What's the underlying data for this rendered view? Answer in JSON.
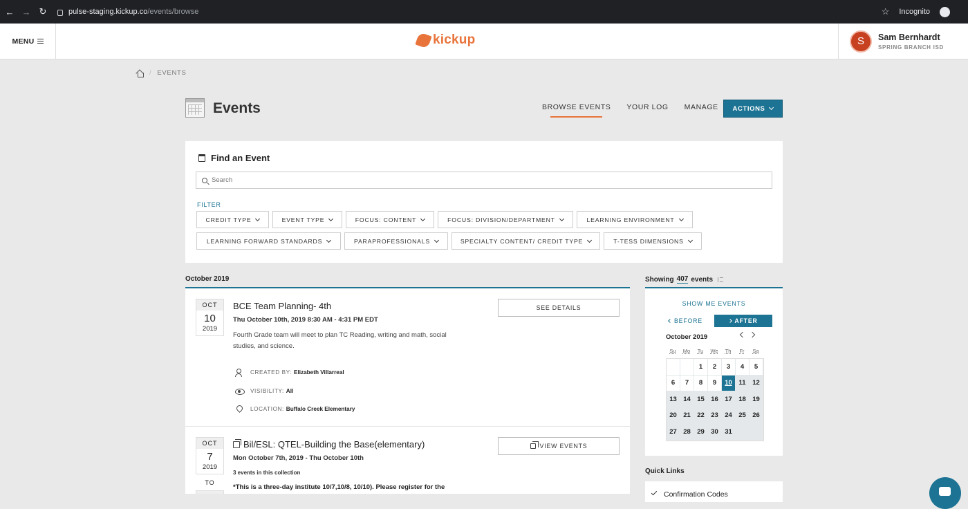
{
  "browser": {
    "host": "pulse-staging.kickup.co",
    "path": "/events/browse",
    "mode_label": "Incognito"
  },
  "app": {
    "menu_label": "MENU",
    "logo_text": "kickup",
    "user_name": "Sam Bernhardt",
    "user_initial": "S",
    "user_org": "SPRING BRANCH ISD"
  },
  "breadcrumb": {
    "current": "EVENTS"
  },
  "page": {
    "title": "Events",
    "tabs": [
      "BROWSE EVENTS",
      "YOUR LOG",
      "MANAGE"
    ],
    "actions_label": "ACTIONS"
  },
  "find": {
    "title": "Find an Event",
    "search_placeholder": "Search",
    "filter_label": "FILTER",
    "filters_row1": [
      "CREDIT TYPE",
      "EVENT TYPE",
      "FOCUS: CONTENT",
      "FOCUS: DIVISION/DEPARTMENT",
      "LEARNING ENVIRONMENT"
    ],
    "filters_row2": [
      "LEARNING FORWARD STANDARDS",
      "PARAPROFESSIONALS",
      "SPECIALTY CONTENT/ CREDIT TYPE",
      "T-TESS DIMENSIONS"
    ]
  },
  "list": {
    "month_label": "October 2019",
    "events": [
      {
        "mon": "OCT",
        "day": "10",
        "year": "2019",
        "title": "BCE Team Planning- 4th",
        "time": "Thu October 10th, 2019 8:30 AM - 4:31 PM EDT",
        "desc": "Fourth Grade team will meet to plan TC Reading, writing and math, social studies, and science.",
        "created_by_label": "CREATED BY:",
        "created_by": "Elizabeth Villarreal",
        "visibility_label": "VISIBILITY:",
        "visibility": "All",
        "location_label": "LOCATION:",
        "location": "Buffalo Creek Elementary",
        "button": "SEE DETAILS"
      },
      {
        "mon": "OCT",
        "day": "7",
        "year": "2019",
        "to_label": "TO",
        "title": "Bil/ESL: QTEL-Building the Base(elementary)",
        "time": "Mon October 7th, 2019 - Thu October 10th",
        "collection": "3 events in this collection",
        "desc": "*This is a three-day institute 10/7,10/8, 10/10). Please register for the",
        "button": "VIEW EVENTS"
      }
    ]
  },
  "sidebar": {
    "showing_prefix": "Showing",
    "count": "407",
    "showing_suffix": "events",
    "show_me": "SHOW ME EVENTS",
    "before": "BEFORE",
    "after": "AFTER",
    "cal_month": "October 2019",
    "dows": [
      "Su",
      "Mo",
      "Tu",
      "We",
      "Th",
      "Fr",
      "Sa"
    ],
    "days": [
      "",
      "",
      "1",
      "2",
      "3",
      "4",
      "5",
      "6",
      "7",
      "8",
      "9",
      "10",
      "11",
      "12",
      "13",
      "14",
      "15",
      "16",
      "17",
      "18",
      "19",
      "20",
      "21",
      "22",
      "23",
      "24",
      "25",
      "26",
      "27",
      "28",
      "29",
      "30",
      "31",
      "",
      ""
    ],
    "selected_day": "10",
    "quick_links_title": "Quick Links",
    "quick_link_1": "Confirmation Codes"
  },
  "colors": {
    "accent": "#1c7393",
    "brand": "#e8743b",
    "avatar": "#c7401f"
  }
}
